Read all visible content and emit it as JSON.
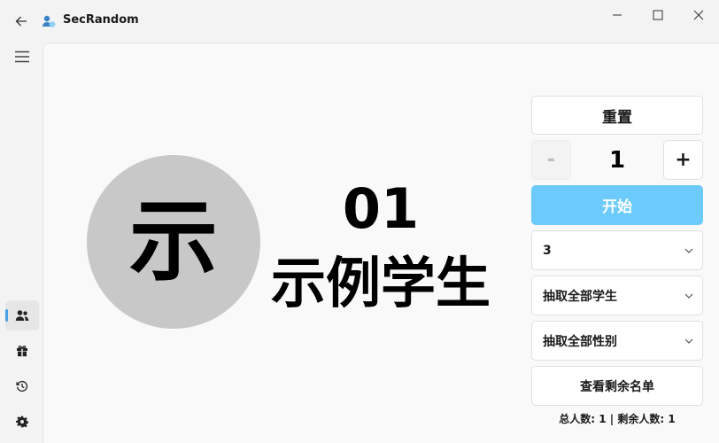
{
  "window": {
    "title": "SecRandom",
    "icons": {
      "back": "back-arrow-icon",
      "logo": "secrandom-logo-icon",
      "minimize": "minimize-icon",
      "maximize": "maximize-icon",
      "close": "close-icon"
    }
  },
  "sidebar": {
    "menu_icon": "hamburger-menu-icon",
    "items": [
      {
        "id": "roll-call",
        "icon": "people-icon",
        "active": true
      },
      {
        "id": "lottery",
        "icon": "gift-icon",
        "active": false
      },
      {
        "id": "history",
        "icon": "history-icon",
        "active": false
      },
      {
        "id": "settings",
        "icon": "gear-icon",
        "active": false
      }
    ],
    "accent_color": "#4aa0e6"
  },
  "main": {
    "avatar_char": "示",
    "student_number": "01",
    "student_name": "示例学生"
  },
  "controls": {
    "reset_label": "重置",
    "stepper": {
      "minus": "-",
      "value": "1",
      "plus": "+"
    },
    "start_label": "开始",
    "start_color": "#6ccbfb",
    "class_select": "3",
    "group_select": "抽取全部学生",
    "gender_select": "抽取全部性别",
    "remaining_label": "查看剩余名单",
    "status": "总人数: 1 | 剩余人数: 1"
  }
}
